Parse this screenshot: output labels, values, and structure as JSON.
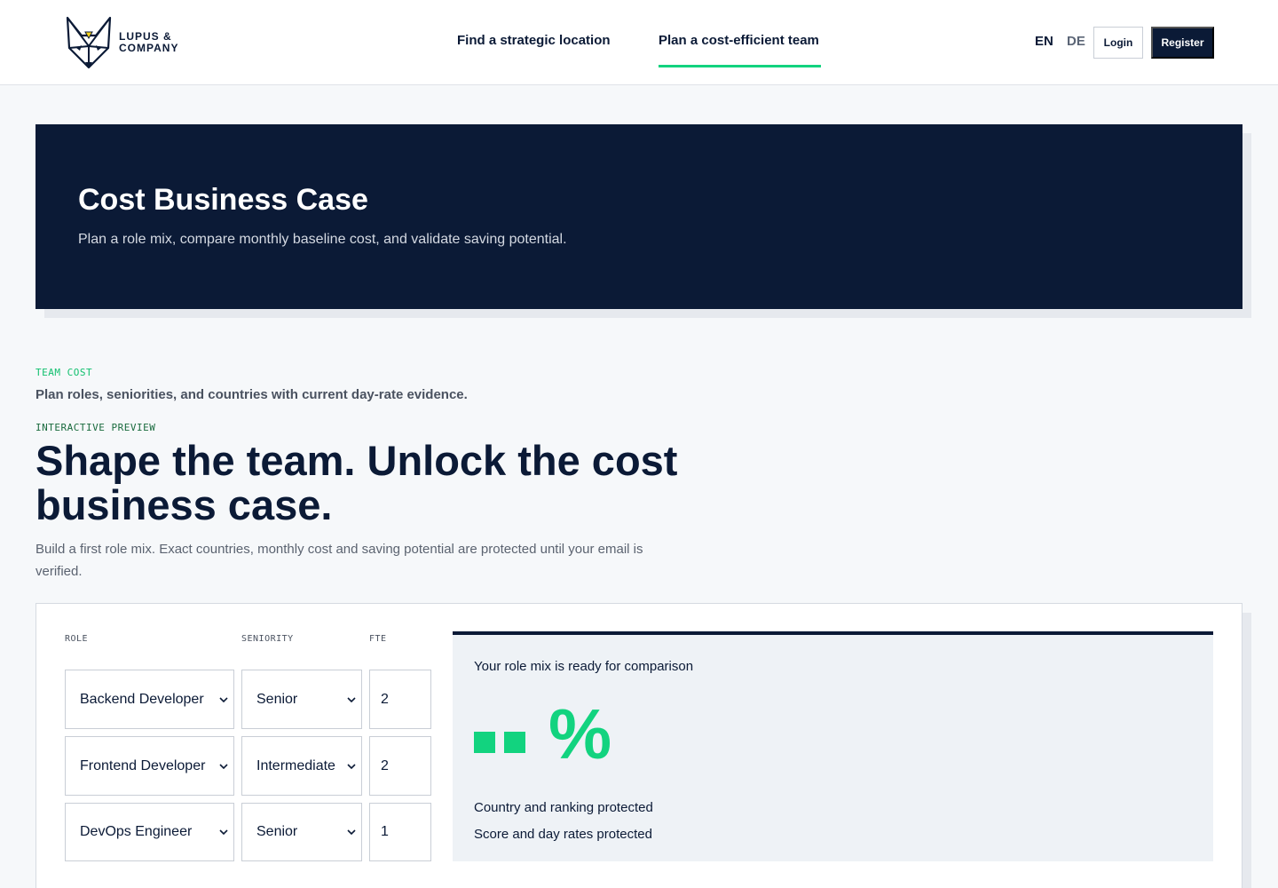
{
  "brand": {
    "name_line1": "LUPUS &",
    "name_line2": "COMPANY"
  },
  "nav": {
    "items": [
      {
        "label": "Find a strategic location"
      },
      {
        "label": "Plan a cost-efficient team",
        "active": true
      }
    ]
  },
  "languages": {
    "en": "EN",
    "de": "DE",
    "active": "EN"
  },
  "auth": {
    "login": "Login",
    "register": "Register"
  },
  "hero": {
    "title": "Cost Business Case",
    "subtitle": "Plan a role mix, compare monthly baseline cost, and validate saving potential."
  },
  "section": {
    "eyebrow": "TEAM COST",
    "intro": "Plan roles, seniorities, and countries with current day-rate evidence.",
    "eyebrow2": "INTERACTIVE PREVIEW",
    "headline": "Shape the team. Unlock the cost business case.",
    "lead": "Build a first role mix. Exact countries, monthly cost and saving potential are protected until your email is verified."
  },
  "planner": {
    "headers": {
      "role": "ROLE",
      "seniority": "SENIORITY",
      "fte": "FTE"
    },
    "rows": [
      {
        "role": "Backend Developer",
        "seniority": "Senior",
        "fte": "2"
      },
      {
        "role": "Frontend Developer",
        "seniority": "Intermediate",
        "fte": "2"
      },
      {
        "role": "DevOps Engineer",
        "seniority": "Senior",
        "fte": "1"
      }
    ]
  },
  "result": {
    "title": "Your role mix is ready for comparison",
    "percent_symbol": "%",
    "line1": "Country and ranking protected",
    "line2": "Score and day rates protected"
  },
  "colors": {
    "navy": "#0b1a36",
    "accent_green": "#12d37f",
    "background": "#f6f8fa"
  }
}
